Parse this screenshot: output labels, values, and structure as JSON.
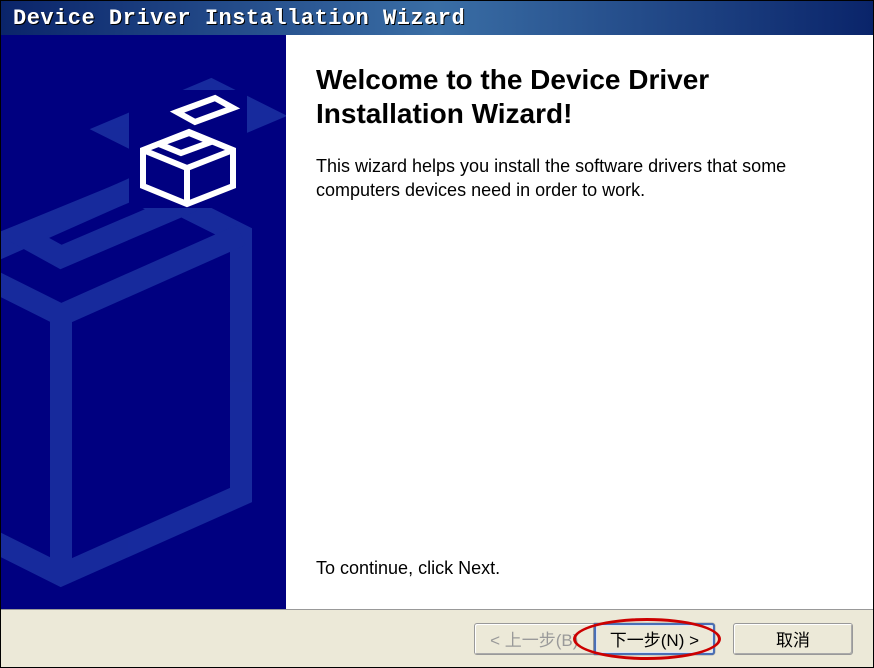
{
  "window": {
    "title": "Device Driver Installation Wizard"
  },
  "wizard": {
    "heading": "Welcome to the Device Driver Installation Wizard!",
    "description": "This wizard helps you install the software drivers that some computers devices need in order to work.",
    "continue_hint": "To continue, click Next."
  },
  "buttons": {
    "back": "< 上一步(B)",
    "next": "下一步(N) >",
    "cancel": "取消"
  },
  "icons": {
    "wizard_graphic": "device-box-icon"
  }
}
